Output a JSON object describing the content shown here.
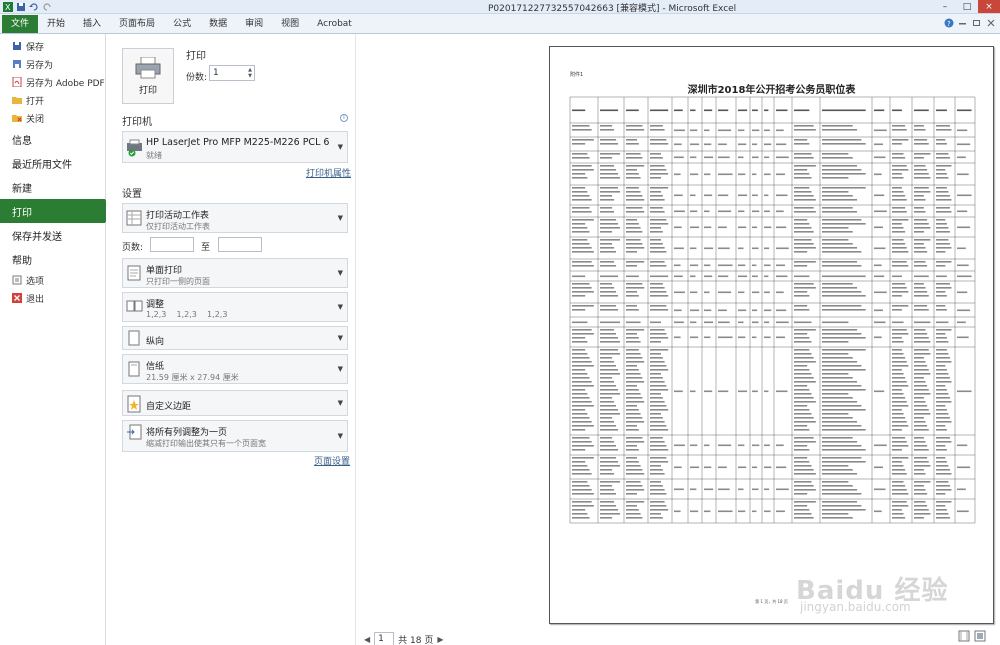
{
  "window": {
    "title": "P020171227732557042663  [兼容模式] - Microsoft Excel"
  },
  "ribbon": {
    "tabs": [
      "文件",
      "开始",
      "插入",
      "页面布局",
      "公式",
      "数据",
      "审阅",
      "视图",
      "Acrobat"
    ]
  },
  "nav": {
    "small_items": [
      {
        "label": "保存",
        "icon": "save-icon"
      },
      {
        "label": "另存为",
        "icon": "save-as-icon"
      },
      {
        "label": "另存为 Adobe PDF",
        "icon": "pdf-icon"
      },
      {
        "label": "打开",
        "icon": "folder-open-icon"
      },
      {
        "label": "关闭",
        "icon": "folder-close-icon"
      }
    ],
    "big_items": [
      "信息",
      "最近所用文件",
      "新建",
      "打印",
      "保存并发送",
      "帮助"
    ],
    "active": "打印",
    "bottom_items": [
      {
        "label": "选项",
        "icon": "options-icon"
      },
      {
        "label": "退出",
        "icon": "exit-icon"
      }
    ]
  },
  "print": {
    "section_title": "打印",
    "button_label": "打印",
    "copies_label": "份数:",
    "copies_value": "1",
    "printer_title": "打印机",
    "printer_name": "HP LaserJet Pro MFP M225-M226 PCL 6",
    "printer_status": "就绪",
    "printer_props_link": "打印机属性",
    "settings_title": "设置",
    "settings": [
      {
        "main": "打印活动工作表",
        "sub": "仅打印活动工作表"
      },
      {
        "main": "单面打印",
        "sub": "只打印一侧的页面"
      },
      {
        "main": "调整",
        "sub": "1,2,3    1,2,3    1,2,3"
      },
      {
        "main": "纵向",
        "sub": ""
      },
      {
        "main": "信纸",
        "sub": "21.59 厘米 x 27.94 厘米"
      },
      {
        "main": "自定义边距",
        "sub": ""
      },
      {
        "main": "将所有列调整为一页",
        "sub": "缩减打印输出使其只有一个页面宽"
      }
    ],
    "pages_label": "页数:",
    "pages_to": "至",
    "page_setup_link": "页面设置"
  },
  "preview": {
    "attachment_label": "附件1",
    "sheet_title": "深圳市2018年公开招考公务员职位表",
    "current_page": "1",
    "total_pages": "共 18 页",
    "footer": "第 1 页，共 18 页",
    "watermark": "Baidu 经验",
    "watermark_url": "jingyan.baidu.com"
  }
}
